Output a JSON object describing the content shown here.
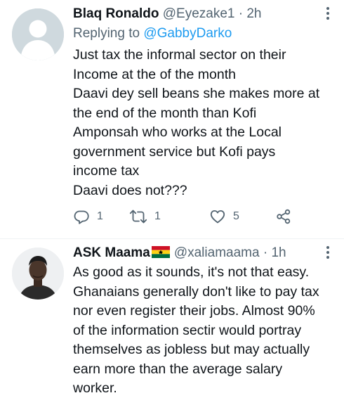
{
  "tweets": [
    {
      "author_name": "Blaq Ronaldo",
      "handle": "@Eyezake1",
      "separator": "·",
      "time": "2h",
      "replying_prefix": "Replying to",
      "replying_to": "@GabbyDarko",
      "text": "Just tax the informal sector on their\nIncome at the of the month\nDaavi dey sell beans she makes more at\nthe end of the month than Kofi\nAmponsah  who works at the Local\ngovernment  service but Kofi pays\nincome tax\nDaavi does not???",
      "reply_count": "1",
      "retweet_count": "1",
      "like_count": "5"
    },
    {
      "author_name": "ASK Maama",
      "handle": "@xaliamaama",
      "separator": "·",
      "time": "1h",
      "text": "As good as it sounds, it's not that easy.\nGhanaians generally don't like to pay tax\nnor even register their jobs. Almost 90%\nof the information sectir would portray\nthemselves as jobless but may actually\nearn more than the average salary\nworker."
    }
  ],
  "colors": {
    "text": "#0f1419",
    "secondary": "#536471",
    "accent": "#1d9bf0",
    "divider": "#eff3f4"
  },
  "icons": {
    "reply": "speech-bubble",
    "retweet": "loop-arrows",
    "like": "heart",
    "share": "share-nodes",
    "more": "vertical-dots",
    "flag": "ghana-flag"
  }
}
